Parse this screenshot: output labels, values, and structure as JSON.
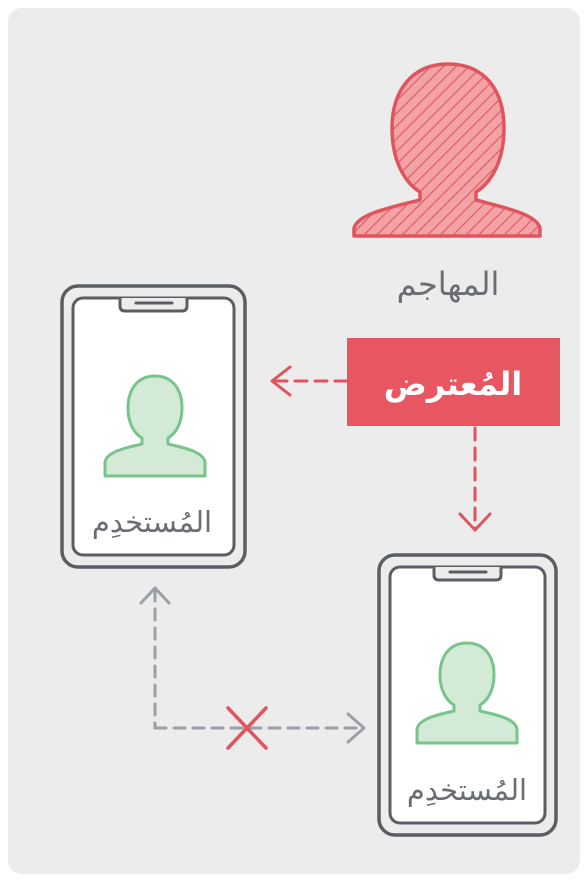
{
  "attacker": {
    "label": "المهاجم"
  },
  "interceptor": {
    "label": "المُعترض"
  },
  "user_left": {
    "label": "المُستخدِم"
  },
  "user_right": {
    "label": "المُستخدِم"
  },
  "colors": {
    "background": "#ececec",
    "attacker_fill": "#f3a3a6",
    "attacker_stroke": "#e0555d",
    "interceptor_box": "#e85661",
    "interceptor_text": "#ffffff",
    "user_fill": "#d3ead6",
    "user_stroke": "#79c48a",
    "phone_stroke": "#5a5e63",
    "attack_arrow": "#e0555d",
    "link_arrow": "#9aa0a6",
    "blocked_mark": "#e0555d",
    "label_text": "#6a6e73"
  },
  "icons": [
    "attacker-silhouette-icon",
    "phone-icon",
    "user-icon",
    "blocked-x-icon"
  ]
}
